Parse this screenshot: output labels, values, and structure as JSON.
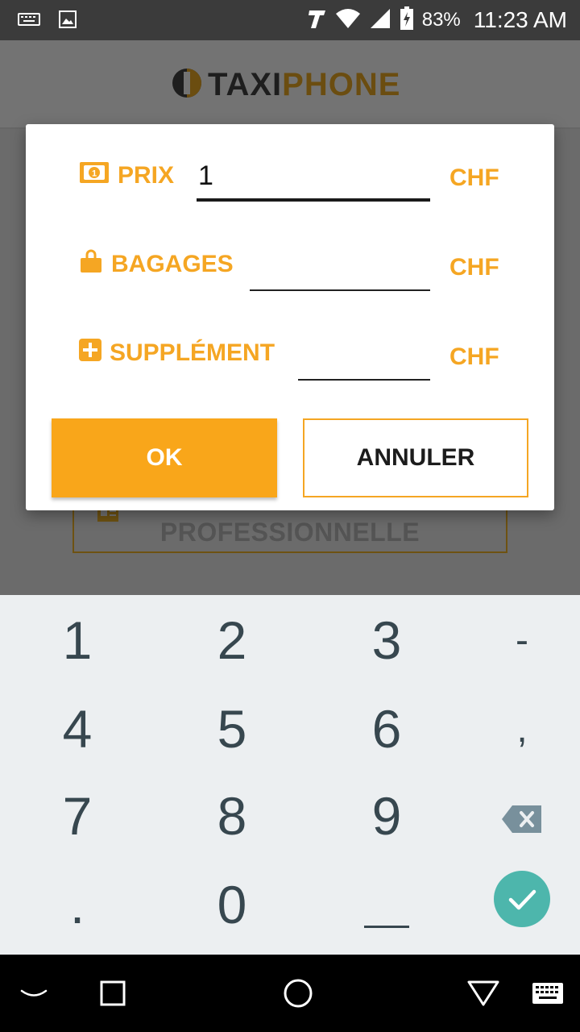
{
  "status_bar": {
    "battery": "83%",
    "time": "11:23 AM"
  },
  "header": {
    "logo_part1": "TAXI",
    "logo_part2": "PHONE"
  },
  "background": {
    "button_label": "PROFESSIONNELLE"
  },
  "dialog": {
    "rows": [
      {
        "label": "PRIX",
        "value": "1",
        "placeholder": "",
        "currency": "CHF",
        "icon": "money-icon"
      },
      {
        "label": "BAGAGES",
        "value": "",
        "placeholder": "",
        "currency": "CHF",
        "icon": "bag-icon"
      },
      {
        "label": "SUPPLÉMENT",
        "value": "",
        "placeholder": "",
        "currency": "CHF",
        "icon": "plus-box-icon"
      }
    ],
    "ok_label": "OK",
    "cancel_label": "ANNULER"
  },
  "keyboard": {
    "keys": [
      "1",
      "2",
      "3",
      "-",
      "4",
      "5",
      "6",
      ",",
      "7",
      "8",
      "9",
      ".",
      "0",
      "_"
    ]
  },
  "colors": {
    "accent": "#f9a61a",
    "confirm": "#4db6ac"
  }
}
